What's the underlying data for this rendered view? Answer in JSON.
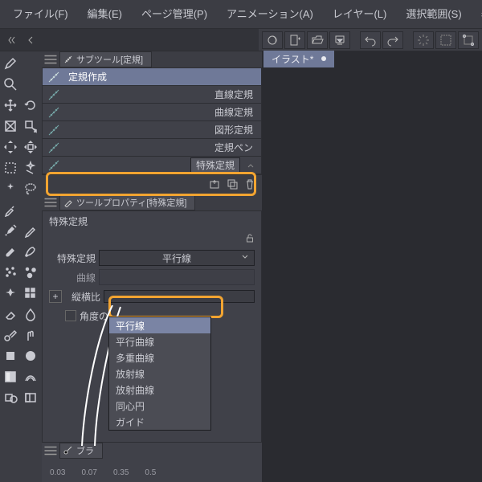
{
  "menu": {
    "file": "ファイル(F)",
    "edit": "編集(E)",
    "page": "ページ管理(P)",
    "anim": "アニメーション(A)",
    "layer": "レイヤー(L)",
    "select": "選択範囲(S)",
    "view": "表示(V"
  },
  "doc": {
    "tab": "イラスト*"
  },
  "subtool": {
    "tab": "サブツール[定規]",
    "items": [
      "定規作成",
      "直線定規",
      "曲線定規",
      "図形定規",
      "定規ペン",
      "特殊定規"
    ]
  },
  "prop": {
    "tab": "ツールプロパティ[特殊定規]",
    "title": "特殊定規",
    "label": "特殊定規",
    "value": "平行線",
    "curve": "曲線",
    "aspect": "縦横比",
    "angle": "角度の"
  },
  "dd": [
    "平行線",
    "平行曲線",
    "多重曲線",
    "放射線",
    "放射曲線",
    "同心円",
    "ガイド"
  ],
  "brush": {
    "tab": "ブラ"
  },
  "ticks": [
    "0.03",
    "0.07",
    "0.35",
    "0.5"
  ]
}
